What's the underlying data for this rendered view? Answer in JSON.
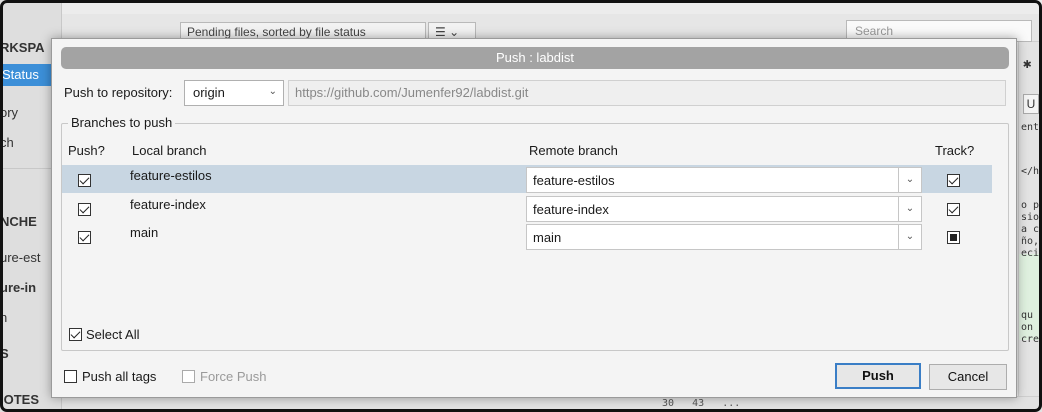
{
  "background": {
    "sidebar": {
      "workspace_header": "RKSPA",
      "items": [
        "Status",
        "ory",
        "ch"
      ],
      "branches_header": "NCHE",
      "branch_items": [
        "ure-est",
        "ure-in",
        "n"
      ],
      "section_s": "S",
      "remotes_header": "IOTES"
    },
    "filter_label": "Pending files, sorted by file status",
    "search_placeholder": "Search",
    "right_code": [
      "ent",
      "</h",
      "o p",
      "sio",
      "a c",
      "ño,",
      "eci",
      "qu",
      "on",
      "cre"
    ],
    "right_button": "U",
    "bottom_numbers": "30   43   ..."
  },
  "dialog": {
    "title": "Push : labdist",
    "repo_label": "Push to repository:",
    "repo_value": "origin",
    "repo_url": "https://github.com/Jumenfer92/labdist.git",
    "group_label": "Branches to push",
    "columns": {
      "push": "Push?",
      "local": "Local branch",
      "remote": "Remote branch",
      "track": "Track?"
    },
    "rows": [
      {
        "local": "feature-estilos",
        "remote": "feature-estilos",
        "push": "checked",
        "track": "checked"
      },
      {
        "local": "feature-index",
        "remote": "feature-index",
        "push": "checked",
        "track": "checked"
      },
      {
        "local": "main",
        "remote": "main",
        "push": "checked",
        "track": "indeterminate"
      }
    ],
    "select_all_label": "Select All",
    "push_all_tags_label": "Push all tags",
    "force_push_label": "Force Push",
    "push_button": "Push",
    "cancel_button": "Cancel"
  }
}
